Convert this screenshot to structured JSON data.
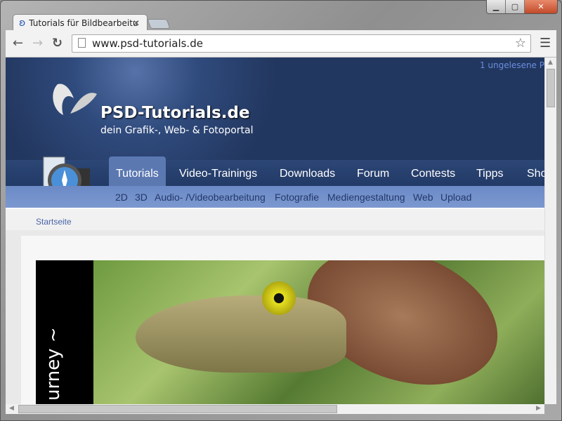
{
  "browser": {
    "tab_title": "Tutorials für Bildbearbeitu",
    "url": "www.psd-tutorials.de"
  },
  "header": {
    "unread": "1 ungelesene P",
    "site_name": "PSD-Tutorials.de",
    "tagline": "dein Grafik-, Web- & Fotoportal"
  },
  "main_nav": [
    {
      "label": "Tutorials",
      "active": true
    },
    {
      "label": "Video-Trainings"
    },
    {
      "label": "Downloads"
    },
    {
      "label": "Forum"
    },
    {
      "label": "Contests"
    },
    {
      "label": "Tipps"
    },
    {
      "label": "Sho"
    }
  ],
  "sub_nav": [
    "2D",
    "3D",
    "Audio- /Videobearbeitung",
    "Fotografie",
    "Mediengestaltung",
    "Web",
    "Upload"
  ],
  "breadcrumb": [
    "Startseite"
  ],
  "banner": {
    "text": "~ Journey Of:",
    "visible_text": "urney ~"
  },
  "colors": {
    "header": "#22375f",
    "nav_active": "#5b78b1",
    "subnav": "#6f8fc9",
    "link": "#4a64a8"
  }
}
